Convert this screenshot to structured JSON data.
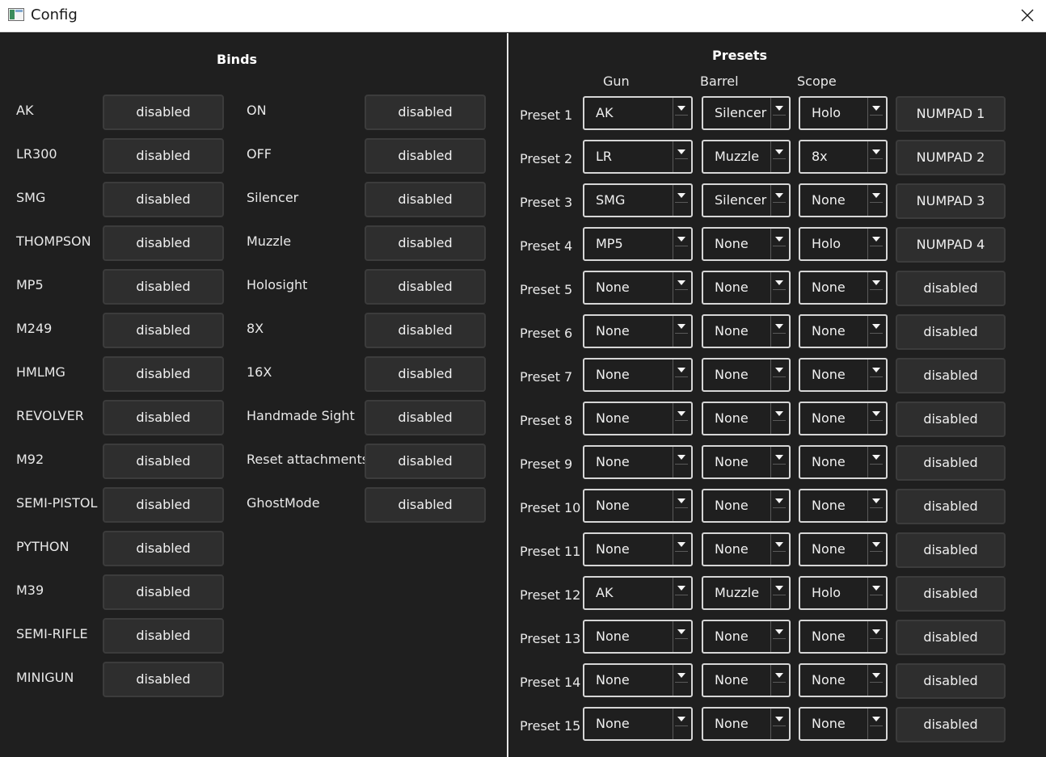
{
  "window": {
    "title": "Config"
  },
  "binds": {
    "heading": "Binds",
    "left": [
      {
        "label": "AK",
        "value": "disabled"
      },
      {
        "label": "LR300",
        "value": "disabled"
      },
      {
        "label": "SMG",
        "value": "disabled"
      },
      {
        "label": "THOMPSON",
        "value": "disabled"
      },
      {
        "label": "MP5",
        "value": "disabled"
      },
      {
        "label": "M249",
        "value": "disabled"
      },
      {
        "label": "HMLMG",
        "value": "disabled"
      },
      {
        "label": "REVOLVER",
        "value": "disabled"
      },
      {
        "label": "M92",
        "value": "disabled"
      },
      {
        "label": "SEMI-PISTOL",
        "value": "disabled"
      },
      {
        "label": "PYTHON",
        "value": "disabled"
      },
      {
        "label": "M39",
        "value": "disabled"
      },
      {
        "label": "SEMI-RIFLE",
        "value": "disabled"
      },
      {
        "label": "MINIGUN",
        "value": "disabled"
      }
    ],
    "right": [
      {
        "label": "ON",
        "value": "disabled"
      },
      {
        "label": "OFF",
        "value": "disabled"
      },
      {
        "label": "Silencer",
        "value": "disabled"
      },
      {
        "label": "Muzzle",
        "value": "disabled"
      },
      {
        "label": "Holosight",
        "value": "disabled"
      },
      {
        "label": "8X",
        "value": "disabled"
      },
      {
        "label": "16X",
        "value": "disabled"
      },
      {
        "label": "Handmade Sight",
        "value": "disabled"
      },
      {
        "label": "Reset attachments",
        "value": "disabled"
      },
      {
        "label": "GhostMode",
        "value": "disabled"
      }
    ]
  },
  "presets": {
    "heading": "Presets",
    "columns": {
      "gun": "Gun",
      "barrel": "Barrel",
      "scope": "Scope"
    },
    "rows": [
      {
        "label": "Preset 1",
        "gun": "AK",
        "barrel": "Silencer",
        "scope": "Holo",
        "key": "NUMPAD 1"
      },
      {
        "label": "Preset 2",
        "gun": "LR",
        "barrel": "Muzzle",
        "scope": "8x",
        "key": "NUMPAD 2"
      },
      {
        "label": "Preset 3",
        "gun": "SMG",
        "barrel": "Silencer",
        "scope": "None",
        "key": "NUMPAD 3"
      },
      {
        "label": "Preset 4",
        "gun": "MP5",
        "barrel": "None",
        "scope": "Holo",
        "key": "NUMPAD 4"
      },
      {
        "label": "Preset 5",
        "gun": "None",
        "barrel": "None",
        "scope": "None",
        "key": "disabled"
      },
      {
        "label": "Preset 6",
        "gun": "None",
        "barrel": "None",
        "scope": "None",
        "key": "disabled"
      },
      {
        "label": "Preset 7",
        "gun": "None",
        "barrel": "None",
        "scope": "None",
        "key": "disabled"
      },
      {
        "label": "Preset 8",
        "gun": "None",
        "barrel": "None",
        "scope": "None",
        "key": "disabled"
      },
      {
        "label": "Preset 9",
        "gun": "None",
        "barrel": "None",
        "scope": "None",
        "key": "disabled"
      },
      {
        "label": "Preset 10",
        "gun": "None",
        "barrel": "None",
        "scope": "None",
        "key": "disabled"
      },
      {
        "label": "Preset 11",
        "gun": "None",
        "barrel": "None",
        "scope": "None",
        "key": "disabled"
      },
      {
        "label": "Preset 12",
        "gun": "AK",
        "barrel": "Muzzle",
        "scope": "Holo",
        "key": "disabled"
      },
      {
        "label": "Preset 13",
        "gun": "None",
        "barrel": "None",
        "scope": "None",
        "key": "disabled"
      },
      {
        "label": "Preset 14",
        "gun": "None",
        "barrel": "None",
        "scope": "None",
        "key": "disabled"
      },
      {
        "label": "Preset 15",
        "gun": "None",
        "barrel": "None",
        "scope": "None",
        "key": "disabled"
      }
    ]
  }
}
